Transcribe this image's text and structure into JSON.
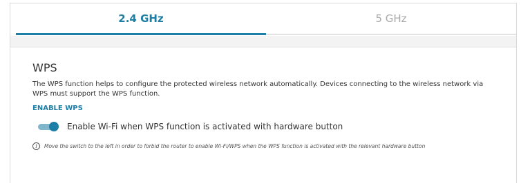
{
  "tabs": [
    {
      "label": "2.4 GHz",
      "active": true
    },
    {
      "label": "5 GHz",
      "active": false
    }
  ],
  "section": {
    "title": "WPS",
    "description": "The WPS function helps to configure the protected wireless network automatically. Devices connecting to the wireless network via WPS must support the WPS function.",
    "enable_link": "ENABLE WPS"
  },
  "toggle": {
    "label": "Enable Wi-Fi when WPS function is activated with hardware button",
    "state": "on"
  },
  "hint": {
    "icon": "info-icon",
    "text": "Move the switch to the left in order to forbid the router to enable Wi-Fi/WPS when the WPS function is activated with the relevant hardware button"
  },
  "colors": {
    "accent": "#1d7fa5",
    "inactive_tab": "#a9a9a9"
  }
}
